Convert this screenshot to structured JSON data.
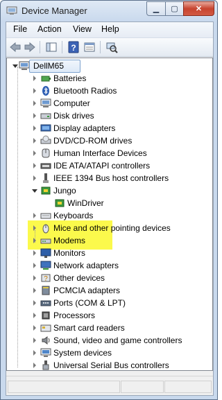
{
  "window": {
    "title": "Device Manager"
  },
  "menu": [
    "File",
    "Action",
    "View",
    "Help"
  ],
  "toolbar": [
    "back-icon",
    "forward-icon",
    "show-hide-console-tree-icon",
    "help-icon",
    "properties-icon",
    "scan-hardware-changes-icon"
  ],
  "tree": {
    "root": "DellM65",
    "categories": [
      {
        "label": "Batteries",
        "icon": "battery-icon"
      },
      {
        "label": "Bluetooth Radios",
        "icon": "bluetooth-icon"
      },
      {
        "label": "Computer",
        "icon": "computer-icon"
      },
      {
        "label": "Disk drives",
        "icon": "disk-drive-icon"
      },
      {
        "label": "Display adapters",
        "icon": "display-adapter-icon"
      },
      {
        "label": "DVD/CD-ROM drives",
        "icon": "dvd-drive-icon"
      },
      {
        "label": "Human Interface Devices",
        "icon": "hid-icon"
      },
      {
        "label": "IDE ATA/ATAPI controllers",
        "icon": "ide-controller-icon"
      },
      {
        "label": "IEEE 1394 Bus host controllers",
        "icon": "firewire-icon"
      },
      {
        "label": "Jungo",
        "icon": "jungo-icon",
        "expanded": true,
        "children": [
          {
            "label": "WinDriver",
            "icon": "windriver-icon"
          }
        ]
      },
      {
        "label": "Keyboards",
        "icon": "keyboard-icon"
      },
      {
        "label": "Mice and other pointing devices",
        "icon": "mouse-icon"
      },
      {
        "label": "Modems",
        "icon": "modem-icon"
      },
      {
        "label": "Monitors",
        "icon": "monitor-icon"
      },
      {
        "label": "Network adapters",
        "icon": "network-adapter-icon"
      },
      {
        "label": "Other devices",
        "icon": "other-devices-icon"
      },
      {
        "label": "PCMCIA adapters",
        "icon": "pcmcia-icon"
      },
      {
        "label": "Ports (COM & LPT)",
        "icon": "ports-icon"
      },
      {
        "label": "Processors",
        "icon": "processor-icon"
      },
      {
        "label": "Smart card readers",
        "icon": "smart-card-icon"
      },
      {
        "label": "Sound, video and game controllers",
        "icon": "sound-icon"
      },
      {
        "label": "System devices",
        "icon": "system-devices-icon"
      },
      {
        "label": "Universal Serial Bus controllers",
        "icon": "usb-icon"
      }
    ]
  },
  "colors": {
    "highlight": "#fbf94c",
    "selection_border": "#7da2ce"
  }
}
